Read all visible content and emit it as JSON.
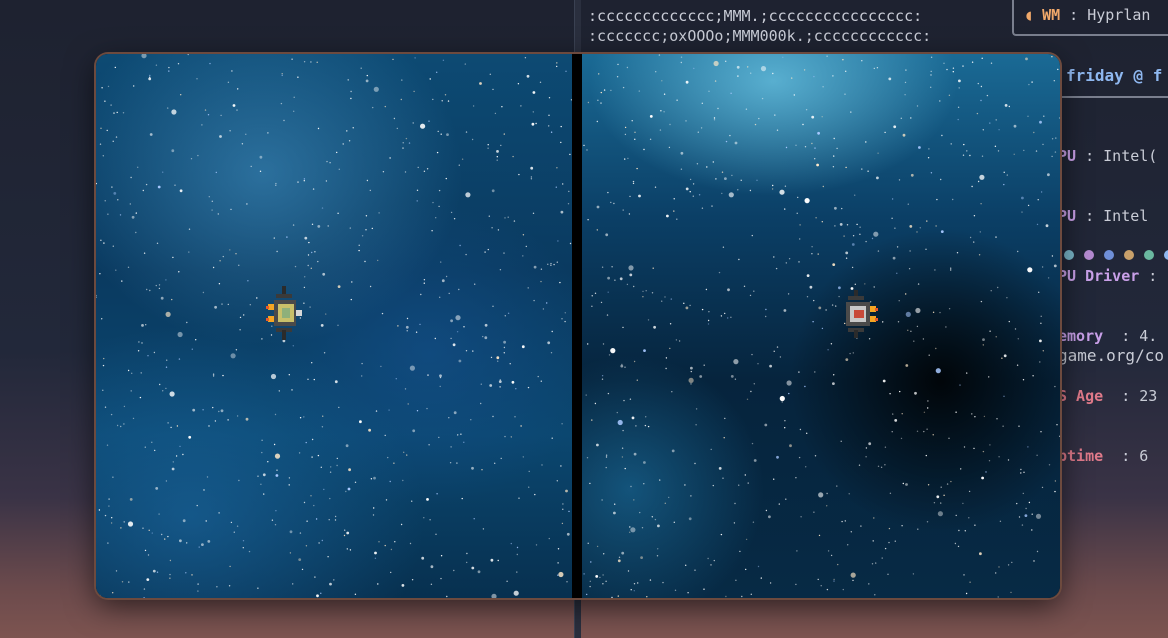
{
  "terminal": {
    "ascii_lines": [
      ":ccccccccccccc;MMM.;cccccccccccccccc:",
      ":ccccccc;oxOOOo;MMM000k.;cccccccccccc:"
    ],
    "wm_label": "WM",
    "wm_value": ": Hyprlan",
    "user_host": "friday @ f",
    "info": [
      {
        "label": "PU",
        "value": " : Intel("
      },
      {
        "label": "PU",
        "value": " : Intel "
      },
      {
        "label": "PU Driver",
        "value": " :"
      },
      {
        "label": "emory",
        "value": "  : 4."
      },
      {
        "label": "S Age",
        "value": "  : 23"
      },
      {
        "label": "ptime",
        "value": "  : 6 "
      }
    ],
    "url": "game.org/co",
    "palette": [
      "#79b6c8",
      "#b48ad0",
      "#6f8fd8",
      "#c8a06a",
      "#6ab8a0",
      "#8fb8f0"
    ]
  },
  "game": {
    "panes": [
      {
        "id": "left",
        "player_ship": "ship-yellow"
      },
      {
        "id": "right",
        "player_ship": "ship-red"
      }
    ]
  }
}
